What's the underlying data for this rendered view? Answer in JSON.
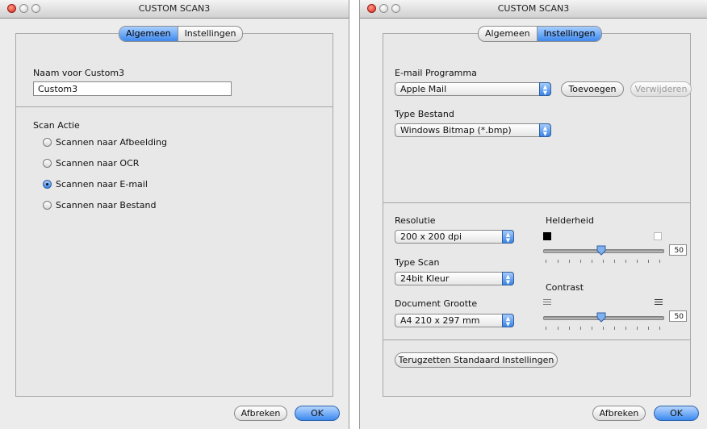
{
  "left_window": {
    "title": "CUSTOM SCAN3",
    "tabs": [
      {
        "label": "Algemeen",
        "active": true
      },
      {
        "label": "Instellingen",
        "active": false
      }
    ],
    "name_label": "Naam voor Custom3",
    "name_value": "Custom3",
    "scan_action_label": "Scan Actie",
    "scan_options": [
      {
        "label": "Scannen naar Afbeelding",
        "selected": false
      },
      {
        "label": "Scannen naar OCR",
        "selected": false
      },
      {
        "label": "Scannen naar E-mail",
        "selected": true
      },
      {
        "label": "Scannen naar Bestand",
        "selected": false
      }
    ],
    "cancel_label": "Afbreken",
    "ok_label": "OK"
  },
  "right_window": {
    "title": "CUSTOM SCAN3",
    "tabs": [
      {
        "label": "Algemeen",
        "active": false
      },
      {
        "label": "Instellingen",
        "active": true
      }
    ],
    "email_program_label": "E-mail Programma",
    "email_program_value": "Apple Mail",
    "add_label": "Toevoegen",
    "remove_label": "Verwijderen",
    "file_type_label": "Type Bestand",
    "file_type_value": "Windows Bitmap (*.bmp)",
    "resolution_label": "Resolutie",
    "resolution_value": "200 x 200 dpi",
    "scan_type_label": "Type Scan",
    "scan_type_value": "24bit Kleur",
    "doc_size_label": "Document Grootte",
    "doc_size_value": "A4 210 x 297 mm",
    "brightness_label": "Helderheid",
    "brightness_value": "50",
    "contrast_label": "Contrast",
    "contrast_value": "50",
    "reset_label": "Terugzetten Standaard Instellingen",
    "cancel_label": "Afbreken",
    "ok_label": "OK"
  },
  "colors": {
    "accent": "#3d89ee",
    "window_bg": "#ececec",
    "close_button": "#d2261d"
  }
}
